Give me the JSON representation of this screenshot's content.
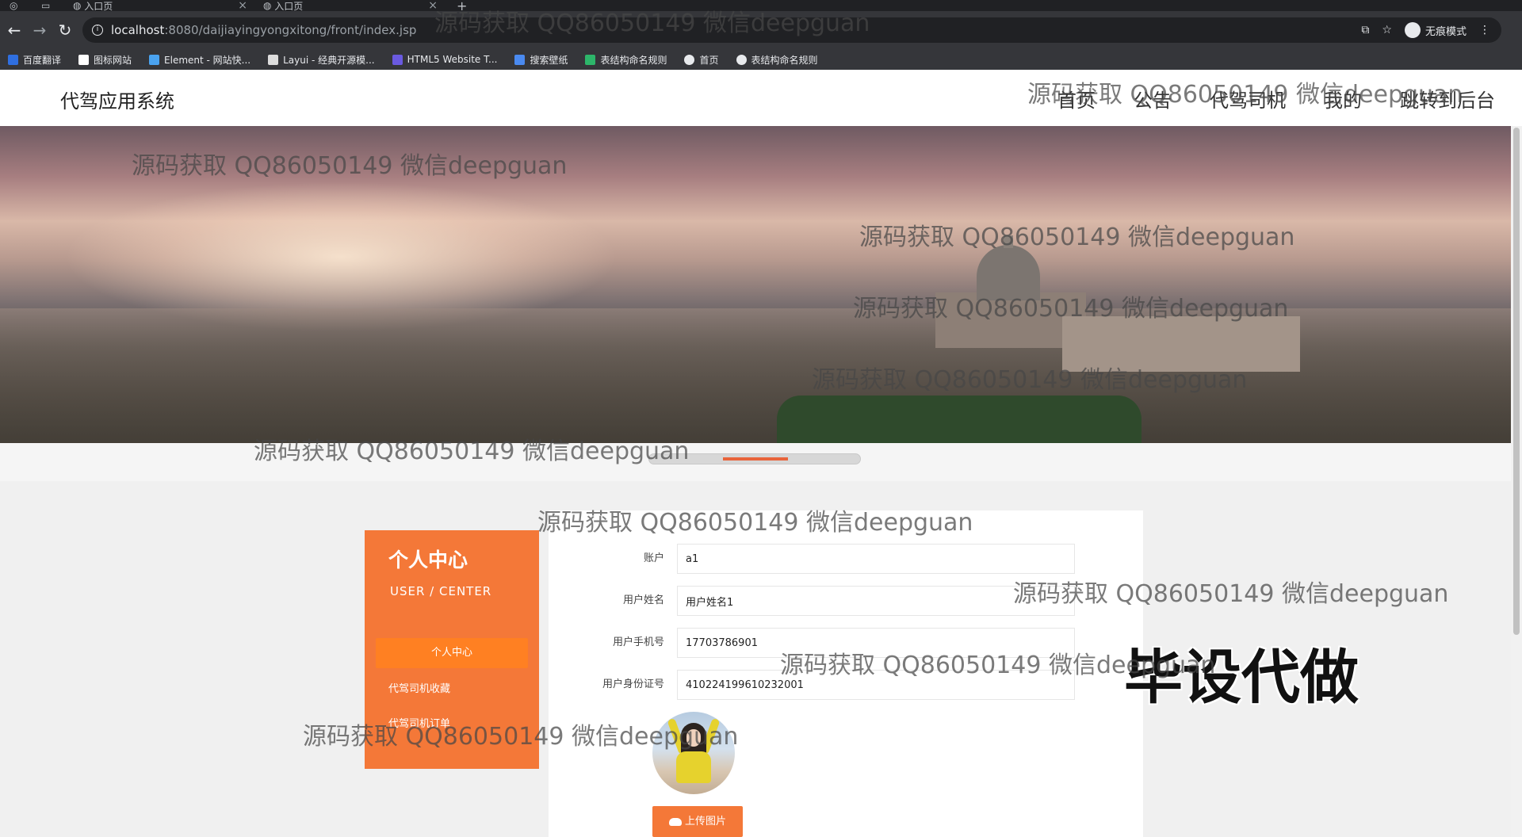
{
  "browser": {
    "tabs": [
      {
        "title": "入口页"
      },
      {
        "title": "入口页"
      }
    ],
    "new_tab": "+",
    "url_host": "localhost",
    "url_rest": ":8080/daijiayingyongxitong/front/index.jsp",
    "profile": "无痕模式",
    "bookmarks": [
      {
        "label": "百度翻译",
        "color": "#2f6fe0"
      },
      {
        "label": "图标网站",
        "color": "#ffffff"
      },
      {
        "label": "Element - 网站快...",
        "color": "#4aa3f0"
      },
      {
        "label": "Layui - 经典开源模...",
        "color": "#dddddd"
      },
      {
        "label": "HTML5 Website T...",
        "color": "#6a5ae0"
      },
      {
        "label": "搜索壁纸",
        "color": "#4a8af0"
      },
      {
        "label": "表结构命名规则",
        "color": "#2db66a"
      },
      {
        "label": "首页",
        "color": "#e8eaed"
      },
      {
        "label": "表结构命名规则",
        "color": "#e8eaed"
      }
    ]
  },
  "header": {
    "brand": "代驾应用系统",
    "nav": [
      "首页",
      "公告",
      "代驾司机",
      "我的",
      "跳转到后台"
    ]
  },
  "sidebar": {
    "title": "个人中心",
    "subtitle": "USER / CENTER",
    "items": [
      "个人中心",
      "代驾司机收藏",
      "代驾司机订单"
    ]
  },
  "form": {
    "fields": [
      {
        "label": "账户",
        "value": "a1"
      },
      {
        "label": "用户姓名",
        "value": "用户姓名1"
      },
      {
        "label": "用户手机号",
        "value": "17703786901"
      },
      {
        "label": "用户身份证号",
        "value": "410224199610232001"
      }
    ],
    "upload_label": "上传图片"
  },
  "stamp": "毕设代做",
  "watermark": "源码获取 QQ86050149 微信deepguan"
}
